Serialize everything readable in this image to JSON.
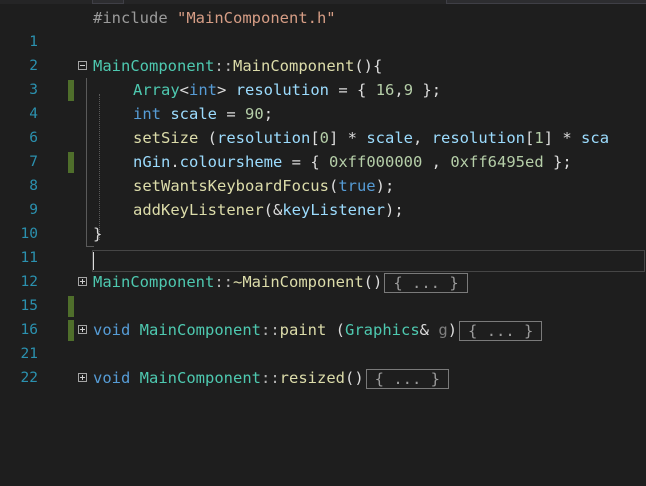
{
  "editor": {
    "line_numbers": [
      "1",
      "2",
      "3",
      "4",
      "6",
      "7",
      "8",
      "9",
      "10",
      "11",
      "12",
      "15",
      "16",
      "21",
      "22"
    ],
    "l1": {
      "pre": "#include ",
      "str": "\"MainComponent.h\""
    },
    "l3": {
      "cls": "MainComponent",
      "sep": "::",
      "fn": "MainComponent",
      "rest": "(){"
    },
    "l4": {
      "ty": "Array",
      "lt": "<",
      "kw": "int",
      "gt": "> ",
      "var": "resolution",
      "eq": " = { ",
      "n1": "16",
      "c": ",",
      "n2": "9",
      "end": " };"
    },
    "l6": {
      "kw": "int",
      "sp": " ",
      "var": "scale",
      "eq": " = ",
      "num": "90",
      "end": ";"
    },
    "l7": {
      "fn": "setSize",
      "a": " (",
      "v1": "resolution",
      "b": "[",
      "n0": "0",
      "c": "] * ",
      "v2": "scale",
      "d": ", ",
      "v3": "resolution",
      "e": "[",
      "n1": "1",
      "f": "] * ",
      "v4": "sca"
    },
    "l8": {
      "var": "nGin",
      "dot": ".",
      "mem": "coloursheme",
      "eq": " = { ",
      "h1": "0xff000000",
      "c": " , ",
      "h2": "0xff6495ed",
      "end": " };"
    },
    "l9": {
      "fn": "setWantsKeyboardFocus",
      "a": "(",
      "kw": "true",
      "end": ");"
    },
    "l10": {
      "fn": "addKeyListener",
      "a": "(&",
      "var": "keyListener",
      "end": ");"
    },
    "l11": {
      "brace": "}"
    },
    "l13": {
      "cls": "MainComponent",
      "sep": "::",
      "fn": "~MainComponent",
      "rest": "()",
      "collapsed": "{ ... }"
    },
    "l15": {
      "kw": "void",
      "sp": " ",
      "cls": "MainComponent",
      "sep": "::",
      "fn": "paint",
      "a": " (",
      "ty": "Graphics",
      "amp": "& ",
      "param": "g",
      "b": ")",
      "collapsed": "{ ... }"
    },
    "l17": {
      "kw": "void",
      "sp": " ",
      "cls": "MainComponent",
      "sep": "::",
      "fn": "resized",
      "rest": "()",
      "collapsed": "{ ... }"
    }
  },
  "colors": {
    "background": "#1e1e1e",
    "line_number": "#2b91af",
    "keyword": "#569cd6",
    "type": "#4ec9b0",
    "function": "#dcdcaa",
    "variable": "#9cdcfe",
    "number": "#b5cea8",
    "string": "#d69d85",
    "change_marker": "#4f6e2b"
  },
  "icons": [
    "collapse-icon",
    "expand-icon"
  ]
}
